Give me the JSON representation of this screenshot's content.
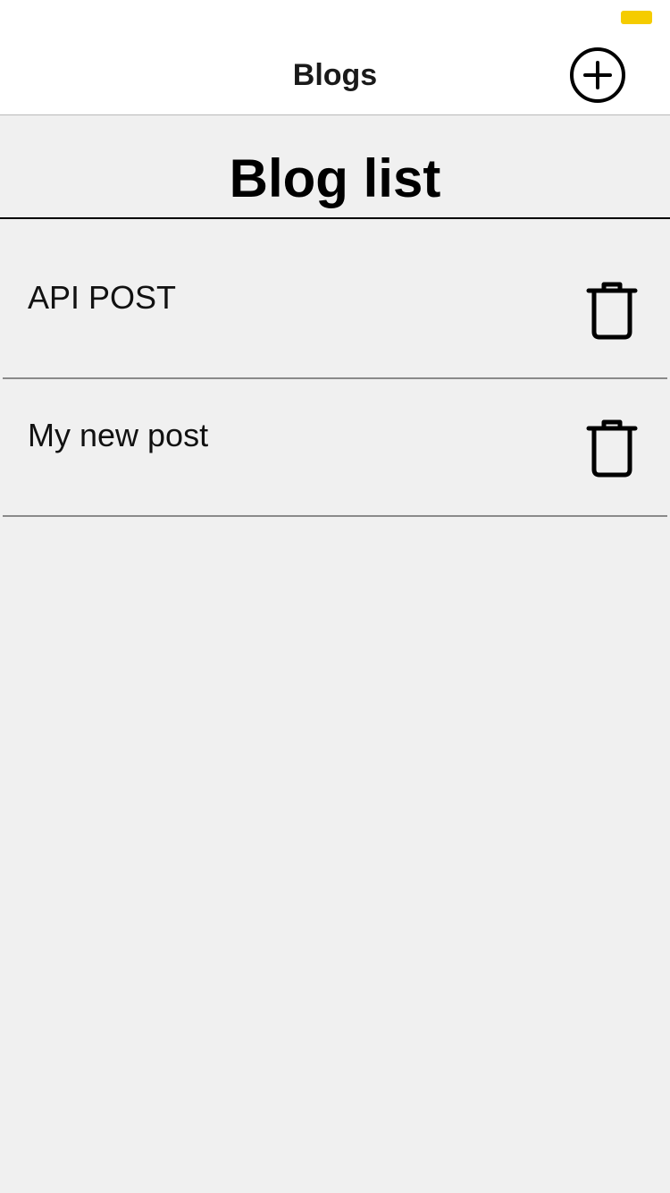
{
  "status_bar": {
    "battery_color": "#f5cc00"
  },
  "header": {
    "title": "Blogs",
    "add_icon": "plus-circle-icon"
  },
  "main": {
    "heading": "Blog list",
    "posts": [
      {
        "title": "API POST",
        "delete_icon": "trash-icon"
      },
      {
        "title": "My new post",
        "delete_icon": "trash-icon"
      }
    ]
  }
}
